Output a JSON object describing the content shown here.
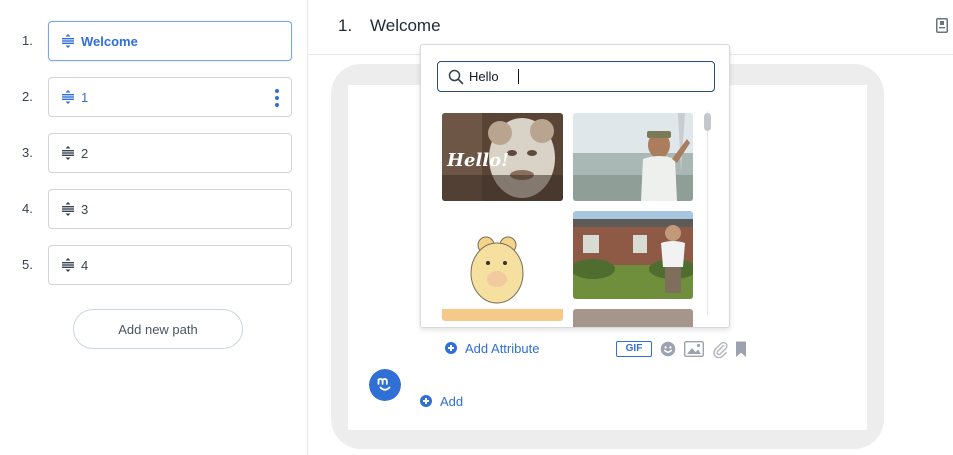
{
  "sidebar": {
    "paths": [
      {
        "number": "1.",
        "label": "Welcome"
      },
      {
        "number": "2.",
        "label": "1"
      },
      {
        "number": "3.",
        "label": "2"
      },
      {
        "number": "4.",
        "label": "3"
      },
      {
        "number": "5.",
        "label": "4"
      }
    ],
    "add_path_label": "Add new path"
  },
  "header": {
    "number": "1.",
    "title": "Welcome"
  },
  "gif_picker": {
    "search_value": "Hello",
    "results": [
      {
        "overlay_text": "Hello!"
      },
      {
        "overlay_text": ""
      },
      {
        "overlay_text": ""
      },
      {
        "overlay_text": ""
      }
    ]
  },
  "composer": {
    "add_attribute_label": "Add Attribute",
    "gif_label": "GIF",
    "add_label": "Add"
  },
  "colors": {
    "accent": "#2f6fd6",
    "active_border": "#7aa7e8",
    "card_frame": "#ededed"
  },
  "icons": {
    "path_drag": "drag-lines-icon",
    "kebab": "more-vertical-icon",
    "search": "search-icon",
    "header": "phone-preview-icon",
    "emoji": "emoji-icon",
    "image": "image-icon",
    "attachment": "paperclip-icon",
    "bookmark": "bookmark-icon"
  }
}
